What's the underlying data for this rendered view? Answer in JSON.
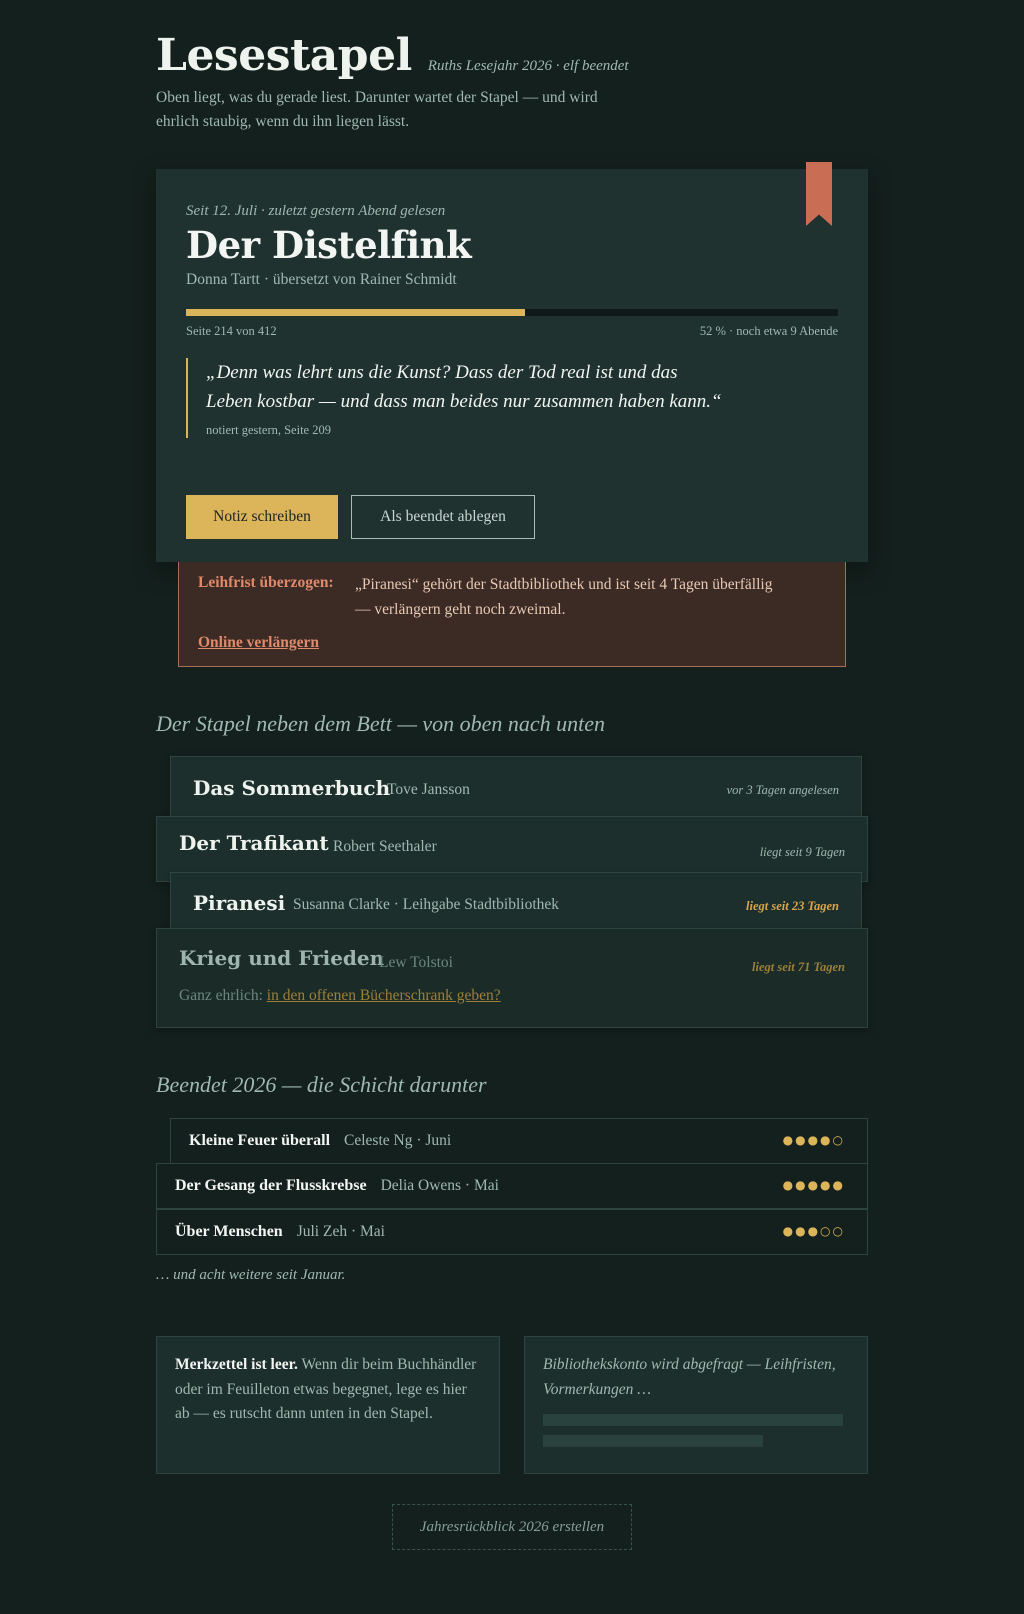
{
  "header": {
    "title": "Lesestapel",
    "subtitle": "Ruths Lesejahr 2026 · elf beendet",
    "intro": "Oben liegt, was du gerade liest. Darunter wartet der Stapel — und wird ehrlich staubig, wenn du ihn liegen lässt."
  },
  "current": {
    "meta": "Seit 12. Juli · zuletzt gestern Abend gelesen",
    "title": "Der Distelfink",
    "author": "Donna Tartt · übersetzt von Rainer Schmidt",
    "progress_fraction": 0.52,
    "progress_left": "Seite 214 von 412",
    "progress_right": "52 % · noch etwa 9 Abende",
    "quote": "„Denn was lehrt uns die Kunst? Dass der Tod real ist und das Leben kostbar — und dass man beides nur zusammen haben kann.“",
    "quote_source": "notiert gestern, Seite 209",
    "btn_note": "Notiz schreiben",
    "btn_done": "Als beendet ablegen"
  },
  "alert": {
    "label": "Leihfrist überzogen:",
    "text": "„Piranesi“ gehört der Stadtbibliothek und ist seit 4 Tagen überfällig — verlängern geht noch zweimal.",
    "link": "Online verlängern"
  },
  "stack": {
    "heading": "Der Stapel neben dem Bett — von oben nach unten",
    "items": [
      {
        "title": "Das Sommerbuch",
        "author": "Tove Jansson",
        "age": "vor 3 Tagen angelesen"
      },
      {
        "title": "Der Trafikant",
        "author": "Robert Seethaler",
        "age": "liegt seit 9 Tagen"
      },
      {
        "title": "Piranesi",
        "author": "Susanna Clarke · Leihgabe Stadtbibliothek",
        "age": "liegt seit 23 Tagen"
      },
      {
        "title": "Krieg und Frieden",
        "author": "Lew Tolstoi",
        "age": "liegt seit 71 Tagen",
        "note_prefix": "Ganz ehrlich:",
        "note_link": "in den offenen Bücherschrank geben?"
      }
    ]
  },
  "finished": {
    "heading": "Beendet 2026 — die Schicht darunter",
    "items": [
      {
        "title": "Kleine Feuer überall",
        "meta": "Celeste Ng · Juni",
        "stars": "●●●●○"
      },
      {
        "title": "Der Gesang der Flusskrebse",
        "meta": "Delia Owens · Mai",
        "stars": "●●●●●"
      },
      {
        "title": "Über Menschen",
        "meta": "Juli Zeh · Mai",
        "stars": "●●●○○"
      }
    ],
    "more": "… und acht weitere seit Januar."
  },
  "wishlist": {
    "bold": "Merkzettel ist leer.",
    "text": " Wenn dir beim Buchhändler oder im Feuilleton etwas begegnet, lege es hier ab — es rutscht dann unten in den Stapel."
  },
  "library": {
    "loading": "Bibliothekskonto wird abgefragt — Leihfristen, Vormerkungen …"
  },
  "footer": {
    "button": "Jahresrückblick 2026 erstellen"
  },
  "colors": {
    "background": "#14201d",
    "accent": "#dcb55a",
    "bookmark": "#c96e55",
    "alert": "#e08a6c"
  }
}
